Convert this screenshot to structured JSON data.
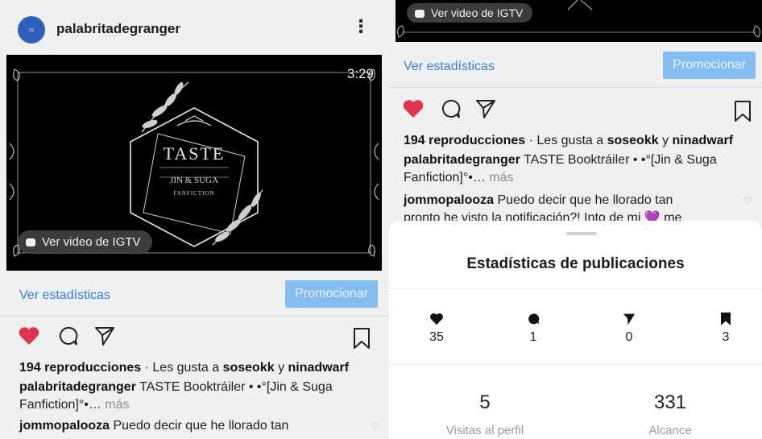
{
  "left": {
    "username": "palabritadegranger",
    "video": {
      "duration": "3:29",
      "igtv_label": "Ver video de IGTV",
      "title": "TASTE",
      "subtitle": "JIN & SUGA",
      "tag": "FANFICTION"
    },
    "stats_link": "Ver estadísticas",
    "promote": "Promocionar",
    "views": "194 reproducciones",
    "likes_prefix": "· Les gusta a",
    "liker1": "soseokk",
    "and": "y",
    "liker2": "ninadwarf",
    "caption_user": "palabritadegranger",
    "caption": "TASTE Booktráiler • •°[Jin & Suga Fanfiction]°•…",
    "more": "más",
    "comment_user": "jommopalooza",
    "comment": "Puedo decir que he llorado tan"
  },
  "right": {
    "igtv_label": "Ver video de IGTV",
    "stats_link": "Ver estadísticas",
    "promote": "Promocionar",
    "views": "194 reproducciones",
    "likes_prefix": "· Les gusta a",
    "liker1": "soseokk",
    "and": "y",
    "liker2": "ninadwarf",
    "caption_user": "palabritadegranger",
    "caption": "TASTE Booktráiler • •°[Jin & Suga Fanfiction]°•…",
    "more": "más",
    "comment_user": "jommopalooza",
    "comment": "Puedo decir que he llorado tan",
    "comment_cut": "pronto he visto la notificación?! Into de mi 💜 me",
    "sheet": {
      "title": "Estadísticas de publicaciones",
      "icons": [
        "heart-icon",
        "comment-icon",
        "send-icon",
        "bookmark-icon"
      ],
      "likes": "35",
      "comments": "1",
      "shares": "0",
      "saves": "3",
      "profile_visits": "5",
      "profile_visits_label": "Visitas al perfil",
      "reach": "331",
      "reach_label": "Alcance"
    }
  },
  "colors": {
    "heart": "#e0344d",
    "link": "#3b7bd4",
    "promote": "#86bdf0",
    "avatar": "#2f5fb8"
  }
}
